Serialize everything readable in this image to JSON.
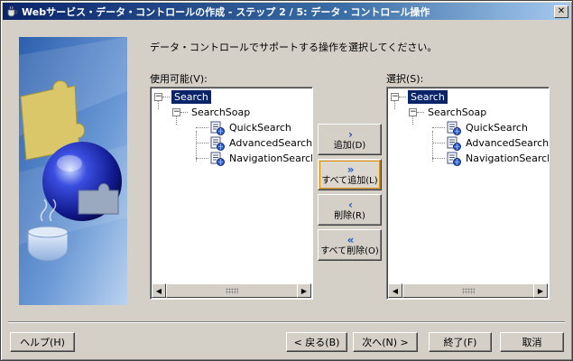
{
  "window": {
    "title": "Webサービス・データ・コントロールの作成 - ステップ 2 / 5: データ・コントロール操作",
    "close_glyph": "✕"
  },
  "instruction": "データ・コントロールでサポートする操作を選択してください。",
  "available": {
    "label": "使用可能(V):",
    "tree": {
      "root": "Search",
      "service": "SearchSoap",
      "operations": [
        "QuickSearch",
        "AdvancedSearch",
        "NavigationSearch"
      ]
    }
  },
  "selected": {
    "label": "選択(S):",
    "tree": {
      "root": "Search",
      "service": "SearchSoap",
      "operations": [
        "QuickSearch",
        "AdvancedSearch",
        "NavigationSearch"
      ]
    }
  },
  "move_buttons": {
    "add": {
      "glyph": "›",
      "label": "追加(D)"
    },
    "add_all": {
      "glyph": "»",
      "label": "すべて追加(L)"
    },
    "remove": {
      "glyph": "‹",
      "label": "削除(R)"
    },
    "remove_all": {
      "glyph": "«",
      "label": "すべて削除(O)"
    }
  },
  "footer": {
    "help": "ヘルプ(H)",
    "back": "< 戻る(B)",
    "next": "次へ(N) >",
    "finish": "終了(F)",
    "cancel": "取消"
  },
  "tree_expander_glyph": "−",
  "scroll_left_glyph": "◀",
  "scroll_right_glyph": "▶",
  "colors": {
    "title_start": "#0a246a",
    "selection": "#0a246a",
    "dialog_bg": "#d4d0c8",
    "move_arrow": "#1b58c8"
  }
}
